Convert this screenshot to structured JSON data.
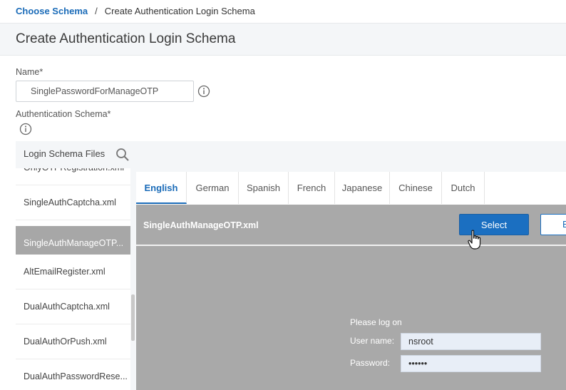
{
  "breadcrumb": {
    "parent": "Choose Schema",
    "separator": "/",
    "current": "Create Authentication Login Schema"
  },
  "page": {
    "title": "Create Authentication Login Schema"
  },
  "form": {
    "name_label": "Name*",
    "name_value": "SinglePasswordForManageOTP",
    "auth_schema_label": "Authentication Schema*"
  },
  "files": {
    "header": "Login Schema Files",
    "items": [
      "OnlyOTPRegistration.xml",
      "SingleAuthCaptcha.xml",
      "SingleAuthManageOTP...",
      "AltEmailRegister.xml",
      "DualAuthCaptcha.xml",
      "DualAuthOrPush.xml",
      "DualAuthPasswordRese..."
    ],
    "selected_index": 2
  },
  "tabs": [
    "English",
    "German",
    "Spanish",
    "French",
    "Japanese",
    "Chinese",
    "Dutch"
  ],
  "active_tab": "English",
  "preview": {
    "filename": "SingleAuthManageOTP.xml",
    "select_label": "Select",
    "edit_label_visible": "E",
    "login_heading": "Please log on",
    "username_label": "User name:",
    "username_value": "nsroot",
    "password_label": "Password:",
    "password_value": "••••••"
  },
  "colors": {
    "accent": "#1b6fc1",
    "link": "#1a6bb8",
    "selected_item": "#a7a7a7",
    "preview_bg": "#a9a9a9"
  },
  "icons": {
    "info": "info-icon",
    "search": "search-icon",
    "cursor": "hand-pointer-icon"
  }
}
